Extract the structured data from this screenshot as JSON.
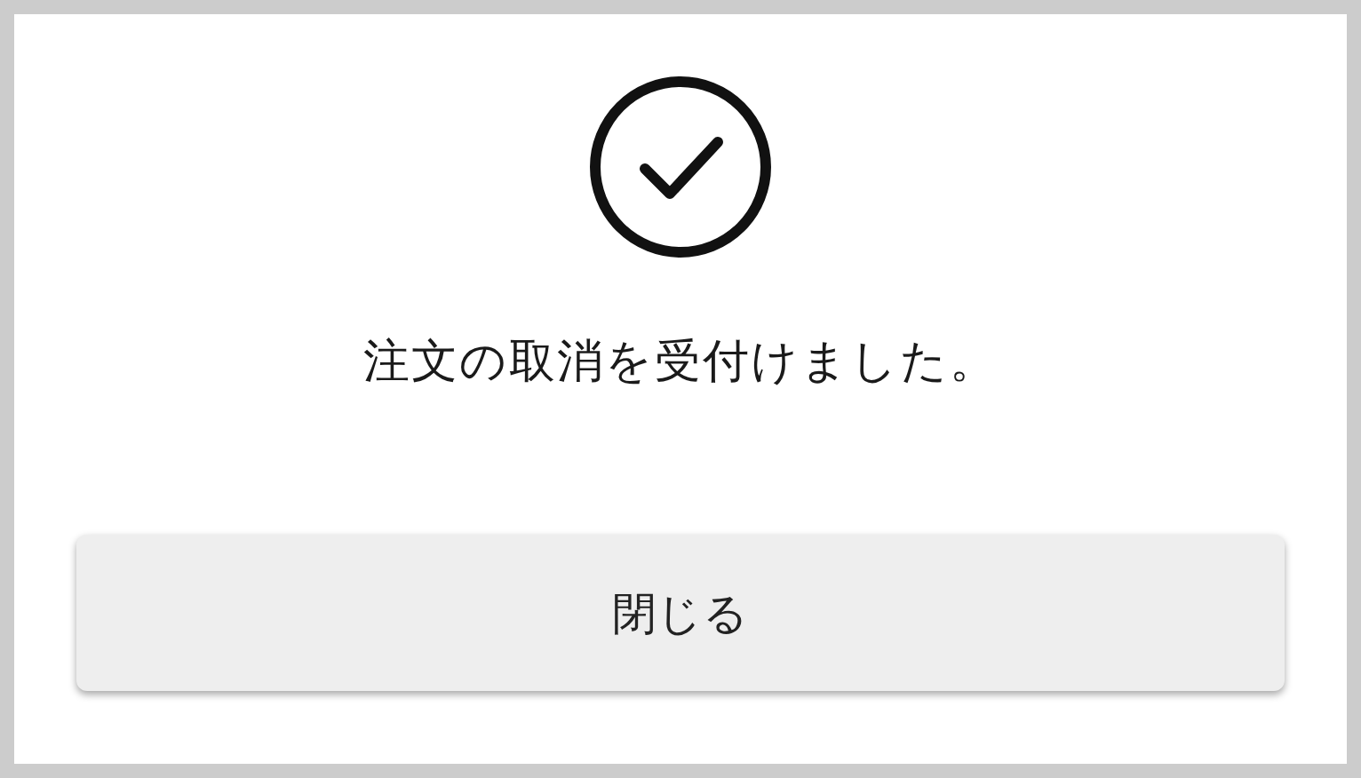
{
  "dialog": {
    "message": "注文の取消を受付けました。",
    "button": "閉じる"
  }
}
